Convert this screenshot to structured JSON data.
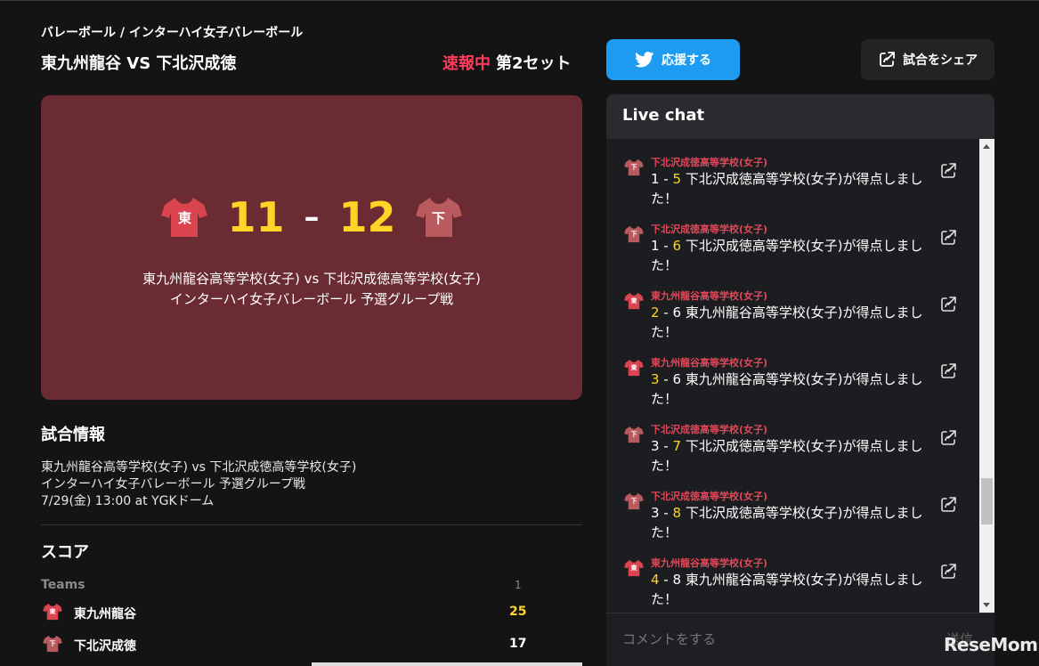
{
  "header": {
    "breadcrumb": "バレーボール / インターハイ女子バレーボール",
    "match_title": "東九州龍谷 VS 下北沢成徳",
    "status_live": "速報中",
    "status_set": "第2セット",
    "cheer_label": "応援する",
    "share_label": "試合をシェア"
  },
  "scoreboard": {
    "home_initial": "東",
    "away_initial": "下",
    "home_score": "11",
    "away_score": "12",
    "dash": "–",
    "line1": "東九州龍谷高等学校(女子) vs 下北沢成徳高等学校(女子)",
    "line2": "インターハイ女子バレーボール 予選グループ戦"
  },
  "info": {
    "title": "試合情報",
    "line1": "東九州龍谷高等学校(女子) vs 下北沢成徳高等学校(女子)",
    "line2": "インターハイ女子バレーボール 予選グループ戦",
    "line3": "7/29(金) 13:00 at YGKドーム"
  },
  "score_table": {
    "title": "スコア",
    "header_teams": "Teams",
    "header_set": "1",
    "rows": [
      {
        "initial": "東",
        "team": "東九州龍谷",
        "set1": "25",
        "color": "#ffd426"
      },
      {
        "initial": "下",
        "team": "下北沢成徳",
        "set1": "17",
        "color": "#ffffff"
      }
    ]
  },
  "chat": {
    "title": "Live chat",
    "input_placeholder": "コメントをする",
    "send_label": "送信",
    "messages": [
      {
        "initial": "下",
        "author": "下北沢成徳高等学校(女子)",
        "left": "1",
        "right": "5",
        "hl": "right",
        "text": "下北沢成徳高等学校(女子)が得点しました！"
      },
      {
        "initial": "下",
        "author": "下北沢成徳高等学校(女子)",
        "left": "1",
        "right": "6",
        "hl": "right",
        "text": "下北沢成徳高等学校(女子)が得点しました！"
      },
      {
        "initial": "東",
        "author": "東九州龍谷高等学校(女子)",
        "left": "2",
        "right": "6",
        "hl": "left",
        "text": "東九州龍谷高等学校(女子)が得点しました！"
      },
      {
        "initial": "東",
        "author": "東九州龍谷高等学校(女子)",
        "left": "3",
        "right": "6",
        "hl": "left",
        "text": "東九州龍谷高等学校(女子)が得点しました！"
      },
      {
        "initial": "下",
        "author": "下北沢成徳高等学校(女子)",
        "left": "3",
        "right": "7",
        "hl": "right",
        "text": "下北沢成徳高等学校(女子)が得点しました！"
      },
      {
        "initial": "下",
        "author": "下北沢成徳高等学校(女子)",
        "left": "3",
        "right": "8",
        "hl": "right",
        "text": "下北沢成徳高等学校(女子)が得点しました！"
      },
      {
        "initial": "東",
        "author": "東九州龍谷高等学校(女子)",
        "left": "4",
        "right": "8",
        "hl": "left",
        "text": "東九州龍谷高等学校(女子)が得点しました！"
      }
    ]
  },
  "watermark": "ReseMom",
  "colors": {
    "live_red": "#ff3b5c",
    "score_yellow": "#ffd426",
    "twitter_blue": "#1d9bf0",
    "scoreboard_bg": "#6b2b33",
    "home_jersey": "#d9444f",
    "away_jersey": "#b85a5e"
  }
}
